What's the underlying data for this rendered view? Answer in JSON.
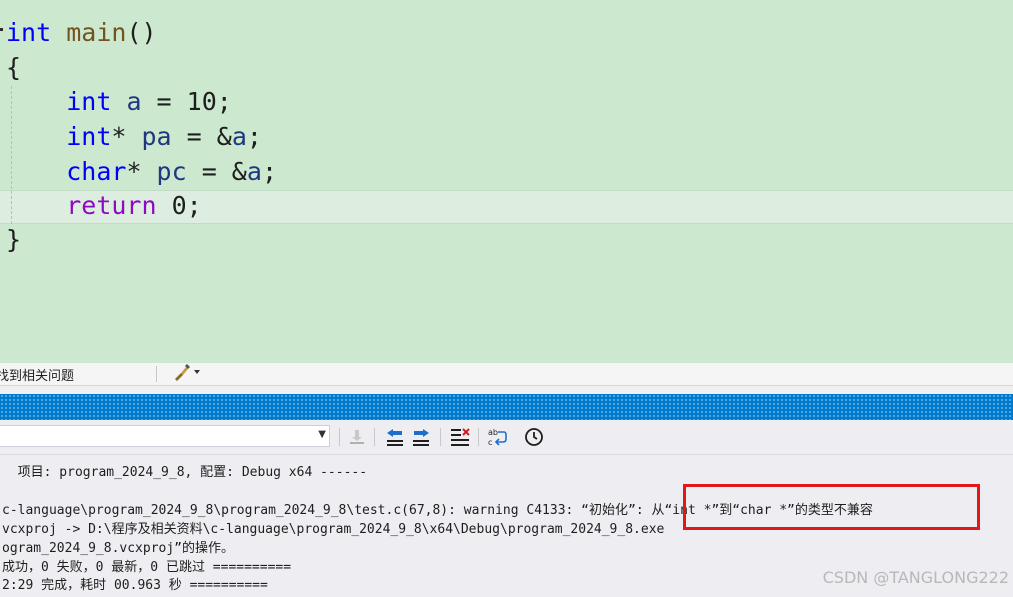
{
  "editor": {
    "lines": [
      [
        {
          "t": "int",
          "c": "kw"
        },
        {
          "t": " ",
          "c": "txt"
        },
        {
          "t": "main",
          "c": "fn"
        },
        {
          "t": "()",
          "c": "txt"
        }
      ],
      [
        {
          "t": "{",
          "c": "txt"
        }
      ],
      [
        {
          "t": "    ",
          "c": "txt"
        },
        {
          "t": "int",
          "c": "kw"
        },
        {
          "t": " ",
          "c": "txt"
        },
        {
          "t": "a",
          "c": "id"
        },
        {
          "t": " = 10;",
          "c": "txt"
        }
      ],
      [
        {
          "t": "    ",
          "c": "txt"
        },
        {
          "t": "int",
          "c": "kw"
        },
        {
          "t": "* ",
          "c": "txt"
        },
        {
          "t": "pa",
          "c": "id"
        },
        {
          "t": " = &",
          "c": "txt"
        },
        {
          "t": "a",
          "c": "id"
        },
        {
          "t": ";",
          "c": "txt"
        }
      ],
      [
        {
          "t": "    ",
          "c": "txt"
        },
        {
          "t": "char",
          "c": "kw"
        },
        {
          "t": "* ",
          "c": "txt"
        },
        {
          "t": "pc",
          "c": "id"
        },
        {
          "t": " = &",
          "c": "txt"
        },
        {
          "t": "a",
          "c": "id"
        },
        {
          "t": ";",
          "c": "txt"
        }
      ],
      [
        {
          "t": "    ",
          "c": "txt"
        },
        {
          "t": "return",
          "c": "kwc"
        },
        {
          "t": " 0;",
          "c": "txt"
        }
      ],
      [
        {
          "t": "}",
          "c": "txt"
        }
      ]
    ]
  },
  "error_list": {
    "filter_label": "找到相关问题"
  },
  "output": {
    "lines": [
      "  项目: program_2024_9_8, 配置: Debug x64 ------",
      "",
      "c-language\\program_2024_9_8\\program_2024_9_8\\test.c(67,8): warning C4133: “初始化”: 从“int *”到“char *”的类型不兼容",
      "vcxproj -> D:\\程序及相关资料\\c-language\\program_2024_9_8\\x64\\Debug\\program_2024_9_8.exe",
      "ogram_2024_9_8.vcxproj”的操作。",
      "成功，0 失败，0 最新，0 已跳过 ==========",
      "2:29 完成，耗时 00.963 秒 =========="
    ]
  },
  "watermark": "CSDN @TANGLONG222",
  "colors": {
    "editor_bg": "#cce8cf",
    "keyword": "#0000ff",
    "control_keyword": "#8f08c4",
    "function": "#74531f",
    "identifier": "#1f377f",
    "title_bar": "#007acc",
    "highlight": "#e0181a"
  },
  "icons": {
    "toolbar": [
      "find-message-icon",
      "prev-message-icon",
      "next-message-icon",
      "clear-all-icon",
      "word-wrap-icon",
      "clock-icon"
    ],
    "strip": "brush-icon"
  }
}
